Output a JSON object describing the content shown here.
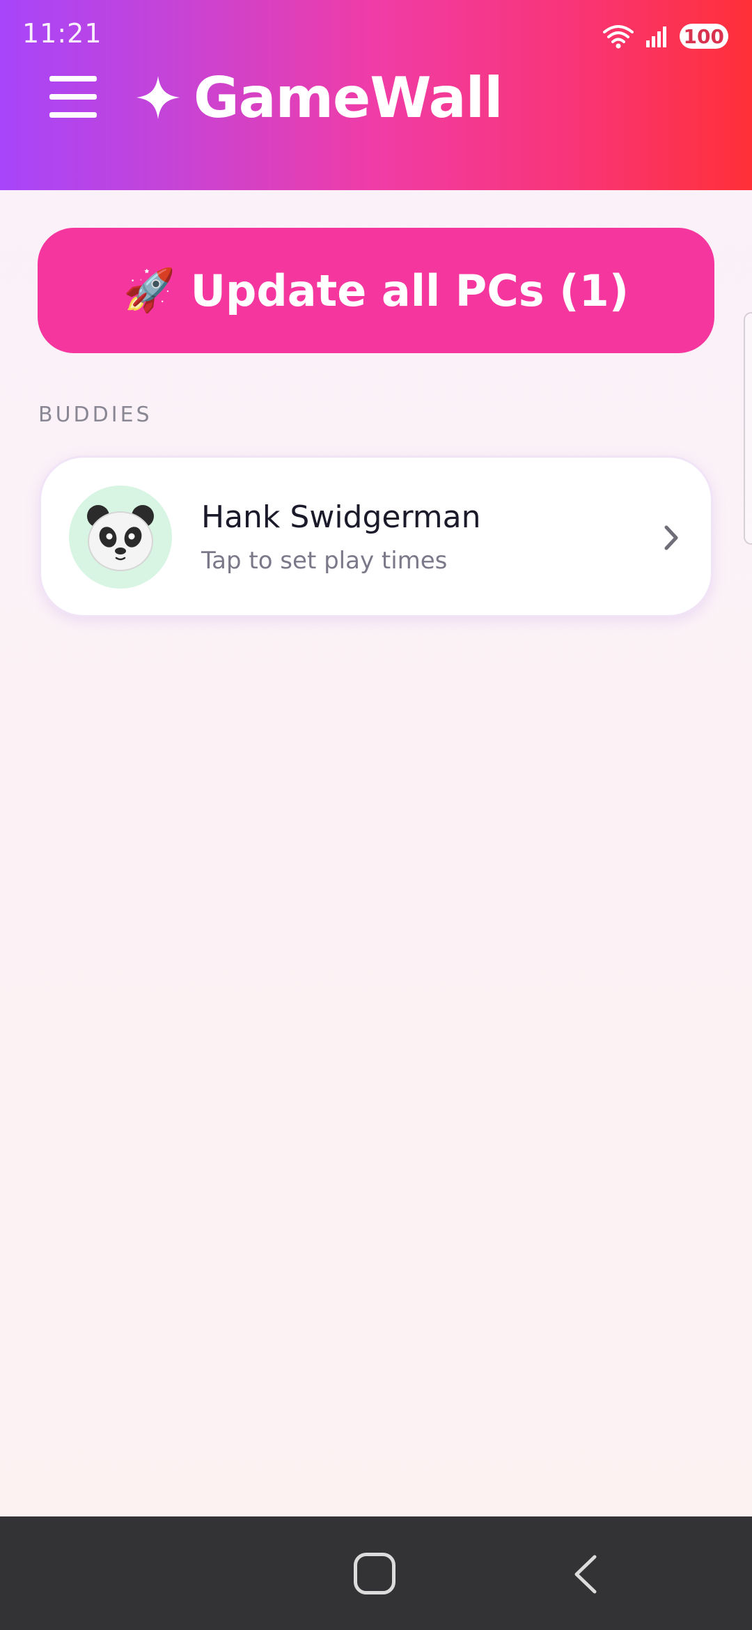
{
  "status_bar": {
    "time": "11:21",
    "battery": "100",
    "icons": [
      "wifi-icon",
      "signal-icon",
      "battery-icon"
    ]
  },
  "header": {
    "title": "GameWall",
    "menu_icon": "hamburger-menu-icon",
    "logo_icon": "sparkle-icon"
  },
  "actions": {
    "update_button": {
      "emoji": "🚀",
      "label": "Update all PCs (1)"
    }
  },
  "buddies": {
    "section_label": "BUDDIES",
    "items": [
      {
        "name": "Hank Swidgerman",
        "subtitle": "Tap to set play times",
        "avatar_icon": "panda-avatar-icon"
      }
    ]
  },
  "colors": {
    "header_gradient": [
      "#a745fa",
      "#f03ca6",
      "#ff3038"
    ],
    "accent": "#f5369f",
    "avatar_bg": "#d8f5e3",
    "nav_bar": "#333234"
  },
  "nav_bar": {
    "icons": [
      "home-icon",
      "back-icon"
    ]
  }
}
